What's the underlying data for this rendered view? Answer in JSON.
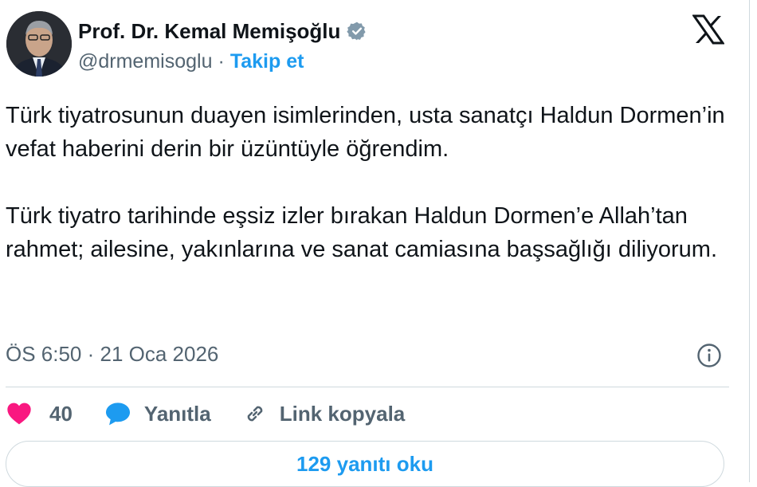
{
  "author": {
    "display_name": "Prof. Dr. Kemal Memişoğlu",
    "handle": "@drmemisoglu",
    "separator": "·",
    "follow_label": "Takip et",
    "verified_icon": "verified-badge-icon"
  },
  "brand": {
    "logo_icon": "x-logo-icon"
  },
  "tweet": {
    "paragraphs": [
      "Türk tiyatrosunun duayen isimlerinden, usta sanatçı Haldun Dormen’in vefat haberini derin bir üzüntüyle öğrendim.",
      "Türk tiyatro tarihinde eşsiz izler bırakan Haldun Dormen’e Allah’tan rahmet; ailesine, yakınlarına ve sanat camiasına başsağlığı diliyorum."
    ],
    "timestamp": "ÖS 6:50 · 21 Oca 2026"
  },
  "actions": {
    "like_count": "40",
    "reply_label": "Yanıtla",
    "copy_link_label": "Link kopyala"
  },
  "footer": {
    "read_replies_label": "129 yanıtı oku"
  },
  "colors": {
    "accent": "#1d9bf0",
    "like": "#f91880",
    "secondary_text": "#536471",
    "primary_text": "#0f1419",
    "border": "#cfd9de"
  }
}
